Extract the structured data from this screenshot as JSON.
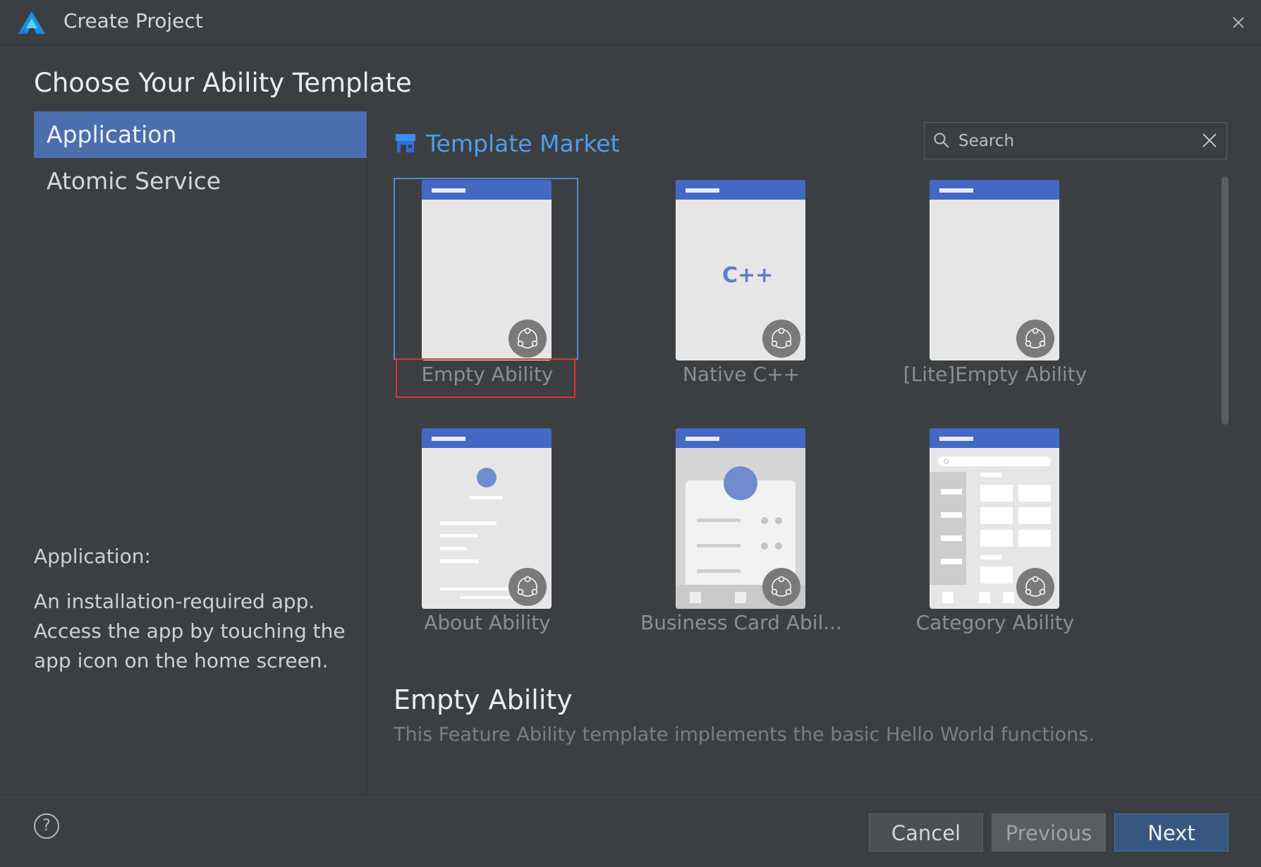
{
  "window": {
    "title": "Create Project"
  },
  "heading": "Choose Your Ability Template",
  "sidebar": {
    "items": [
      {
        "label": "Application",
        "selected": true
      },
      {
        "label": "Atomic Service",
        "selected": false
      }
    ],
    "description_title": "Application:",
    "description": "An installation-required app. Access the app by touching the app icon on the home screen."
  },
  "market": {
    "title": "Template Market",
    "icon": "store-icon"
  },
  "search": {
    "placeholder": "Search",
    "value": ""
  },
  "templates": [
    {
      "label": "Empty Ability",
      "selected": true,
      "preview": "blank"
    },
    {
      "label": "Native C++",
      "selected": false,
      "preview": "cpp",
      "thumb_text": "C++"
    },
    {
      "label": "[Lite]Empty Ability",
      "selected": false,
      "preview": "blank"
    },
    {
      "label": "About Ability",
      "selected": false,
      "preview": "about"
    },
    {
      "label": "Business Card Abil...",
      "selected": false,
      "preview": "business-card"
    },
    {
      "label": "Category Ability",
      "selected": false,
      "preview": "category"
    }
  ],
  "detail": {
    "title": "Empty Ability",
    "description": "This Feature Ability template implements the basic Hello World functions."
  },
  "footer": {
    "help_label": "?",
    "cancel_label": "Cancel",
    "previous_label": "Previous",
    "next_label": "Next"
  },
  "colors": {
    "accent": "#4e9cf0",
    "selection": "#4b6eaf",
    "primary_button": "#365880",
    "highlight_red": "#d83434"
  }
}
